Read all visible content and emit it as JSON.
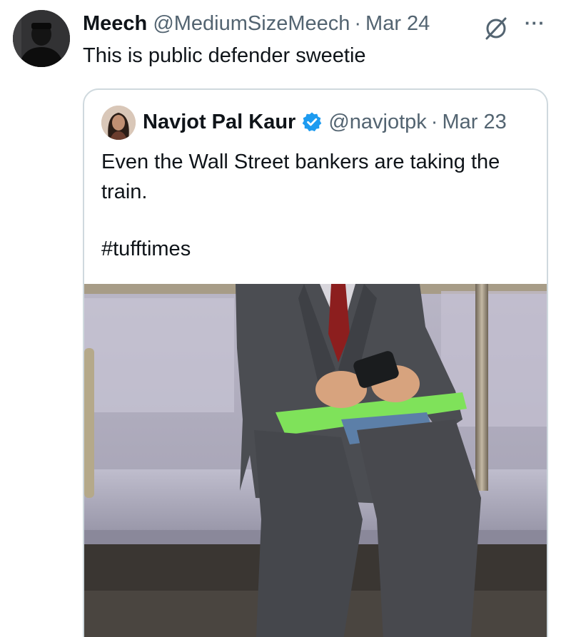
{
  "tweet": {
    "author_name": "Meech",
    "author_handle": "@MediumSizeMeech",
    "separator": "·",
    "date": "Mar 24",
    "text": "This is public defender sweetie",
    "more_label": "···",
    "avatar_icon": "avatar-photo",
    "action_icon": "no-sign-icon"
  },
  "quoted_tweet": {
    "author_name": "Navjot Pal Kaur",
    "verified": true,
    "verified_color": "#1d9bf0",
    "author_handle": "@navjotpk",
    "separator": "·",
    "date": "Mar 23",
    "text": "Even the Wall Street bankers are taking the train.",
    "hashtag": "#tufftimes",
    "media_icon": "subway-photo"
  },
  "colors": {
    "text_primary": "#0f1419",
    "text_secondary": "#536471",
    "card_border": "#cfd9de",
    "accent_blue": "#1d9bf0"
  }
}
